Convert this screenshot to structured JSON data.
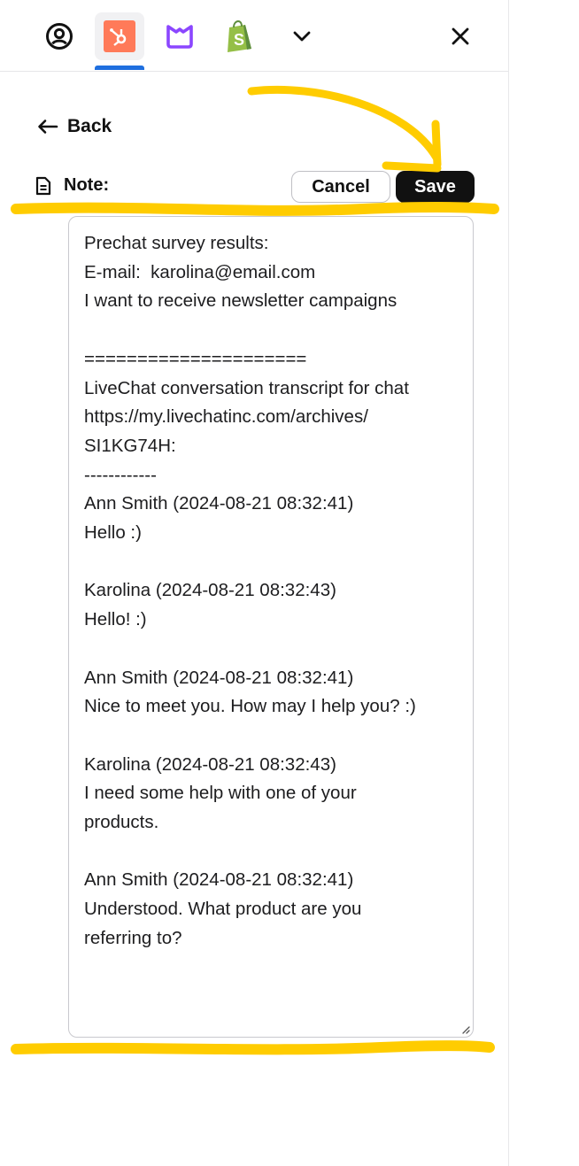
{
  "toolbar": {
    "icons": [
      "user-circle-icon",
      "hubspot-icon",
      "livechat-icon",
      "shopify-icon",
      "chevron-down-icon",
      "close-icon"
    ],
    "active_app": "hubspot-icon",
    "colors": {
      "hubspot": "#ff7a59",
      "livechat": "#8b46ff",
      "shopify": "#95bf47",
      "active_indicator": "#1f6fdf"
    }
  },
  "back": {
    "label": "Back"
  },
  "note": {
    "label": "Note:",
    "cancel_label": "Cancel",
    "save_label": "Save",
    "value": "Prechat survey results:\nE-mail:  karolina@email.com\nI want to receive newsletter campaigns\n\n=====================\nLiveChat conversation transcript for chat\nhttps://my.livechatinc.com/archives/\nSI1KG74H:\n------------\nAnn Smith (2024-08-21 08:32:41)\nHello :)\n\nKarolina (2024-08-21 08:32:43)\nHello! :)\n\nAnn Smith (2024-08-21 08:32:41)\nNice to meet you. How may I help you? :)\n\nKarolina (2024-08-21 08:32:43)\nI need some help with one of your\nproducts.\n\nAnn Smith (2024-08-21 08:32:41)\nUnderstood. What product are you\nreferring to?"
  },
  "annotation": {
    "color": "#ffcc00"
  }
}
